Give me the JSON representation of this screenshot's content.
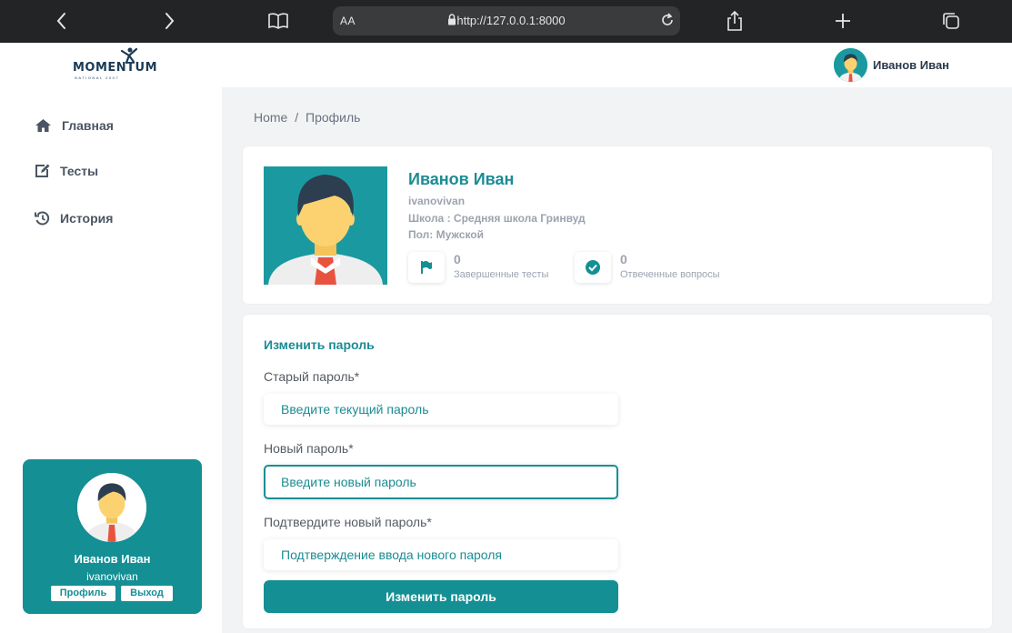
{
  "browser": {
    "text_size_label": "AA",
    "url": "http://127.0.0.1:8000",
    "icons": [
      "back-icon",
      "forward-icon",
      "book-icon",
      "lock-icon",
      "reload-icon",
      "share-icon",
      "plus-icon",
      "tabs-icon"
    ]
  },
  "header": {
    "logo_text": "MOMENTUM",
    "logo_subtext": "NATIONAL 2007",
    "user_name": "Иванов Иван"
  },
  "sidebar": {
    "items": [
      {
        "label": "Главная",
        "icon": "home-icon"
      },
      {
        "label": "Тесты",
        "icon": "edit-icon"
      },
      {
        "label": "История",
        "icon": "history-icon"
      }
    ],
    "profile": {
      "name": "Иванов Иван",
      "username": "ivanovivan",
      "profile_button": "Профиль",
      "logout_button": "Выход"
    }
  },
  "breadcrumb": {
    "home": "Home",
    "separator": "/",
    "current": "Профиль"
  },
  "profile": {
    "name": "Иванов Иван",
    "username": "ivanovivan",
    "school": "Школа : Средняя школа Гринвуд",
    "gender": "Пол: Мужской",
    "stats": [
      {
        "value": "0",
        "label": "Завершенные тесты",
        "icon": "flag-icon"
      },
      {
        "value": "0",
        "label": "Отвеченные вопросы",
        "icon": "check-circle-icon"
      }
    ]
  },
  "password_form": {
    "title": "Изменить пароль",
    "old_label": "Старый пароль*",
    "old_placeholder": "Введите текущий пароль",
    "new_label": "Новый пароль*",
    "new_placeholder": "Введите новый пароль",
    "confirm_label": "Подтвердите новый пароль*",
    "confirm_placeholder": "Подтверждение ввода нового пароля",
    "submit_label": "Изменить пароль"
  },
  "colors": {
    "accent": "#148f94",
    "accent_text": "#1b8c93",
    "browser_bar": "#232426",
    "page_bg": "#f2f3f5"
  }
}
